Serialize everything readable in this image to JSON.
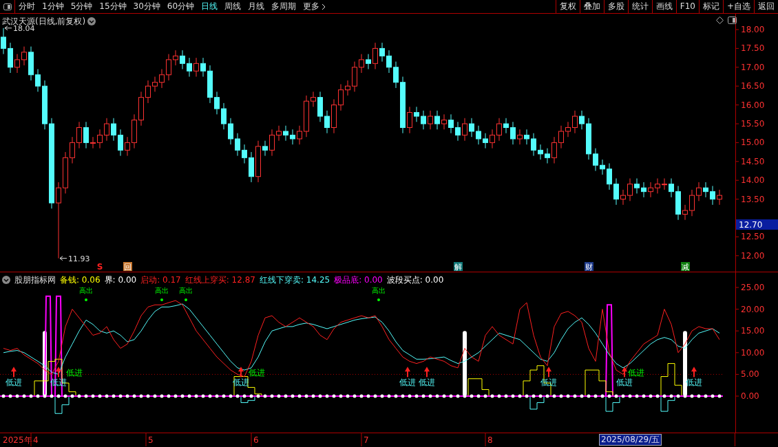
{
  "toolbar": {
    "periods": [
      {
        "label": "分时",
        "selected": false
      },
      {
        "label": "1分钟",
        "selected": false
      },
      {
        "label": "5分钟",
        "selected": false
      },
      {
        "label": "15分钟",
        "selected": false
      },
      {
        "label": "30分钟",
        "selected": false
      },
      {
        "label": "60分钟",
        "selected": false
      },
      {
        "label": "日线",
        "selected": true
      },
      {
        "label": "周线",
        "selected": false
      },
      {
        "label": "月线",
        "selected": false
      },
      {
        "label": "多周期",
        "selected": false
      }
    ],
    "more": "更多",
    "buttons": [
      "复权",
      "叠加",
      "多股",
      "统计",
      "画线",
      "F10",
      "标记",
      "+自选",
      "返回"
    ]
  },
  "main_chart": {
    "title": "武汉天源(日线,前复权)",
    "current_price": "12.70",
    "high_label": "18.04",
    "low_label": "11.93",
    "price_axis": [
      "18.00",
      "17.50",
      "17.00",
      "16.50",
      "16.00",
      "15.50",
      "15.00",
      "14.50",
      "14.00",
      "13.50",
      "12.50",
      "12.00"
    ],
    "events": [
      {
        "kind": "text",
        "text": "S"
      },
      {
        "kind": "tag",
        "text": "回",
        "color": "#c87830"
      },
      {
        "kind": "tag",
        "text": "解",
        "color": "#107878"
      },
      {
        "kind": "tag",
        "text": "财",
        "color": "#203c8c"
      },
      {
        "kind": "tag",
        "text": "减",
        "color": "#108010"
      }
    ]
  },
  "indicator": {
    "name": "股朋指标网",
    "legend": [
      {
        "label": "备钱:",
        "value": "0.06",
        "color": "#ffff00"
      },
      {
        "label": "界:",
        "value": "0.00",
        "color": "#ffffff"
      },
      {
        "label": "启动:",
        "value": "0.17",
        "color": "#ff2020"
      },
      {
        "label": "红线上穿买:",
        "value": "12.87",
        "color": "#ff2020"
      },
      {
        "label": "红线下穿卖:",
        "value": "14.25",
        "color": "#54fcfc"
      },
      {
        "label": "极品底:",
        "value": "0.00",
        "color": "#ff00ff"
      },
      {
        "label": "波段买点:",
        "value": "0.00",
        "color": "#ffffff"
      }
    ],
    "value_axis": [
      "25.00",
      "20.00",
      "15.00",
      "10.00",
      "5.00",
      "0.00"
    ],
    "signals": [
      {
        "kind": "exit",
        "text": "高出"
      },
      {
        "kind": "exit",
        "text": "高出"
      },
      {
        "kind": "exit",
        "text": "高出"
      },
      {
        "kind": "exit",
        "text": "高出"
      },
      {
        "kind": "entry",
        "text": "低进"
      },
      {
        "kind": "entry",
        "text": "低进"
      },
      {
        "kind": "entry",
        "text": "低进"
      },
      {
        "kind": "entry",
        "text": "低进"
      },
      {
        "kind": "entry",
        "text": "低进"
      },
      {
        "kind": "entry",
        "text": "低进"
      },
      {
        "kind": "entry",
        "text": "低进"
      },
      {
        "kind": "entry",
        "text": "低进"
      },
      {
        "kind": "entry_mark",
        "text": "低进"
      },
      {
        "kind": "entry_mark",
        "text": "低进"
      },
      {
        "kind": "entry_mark",
        "text": "低进"
      }
    ]
  },
  "date_axis": {
    "year": "2025年",
    "months": [
      "4",
      "5",
      "6",
      "7",
      "8"
    ],
    "cursor_date": "2025/08/29/五"
  }
}
